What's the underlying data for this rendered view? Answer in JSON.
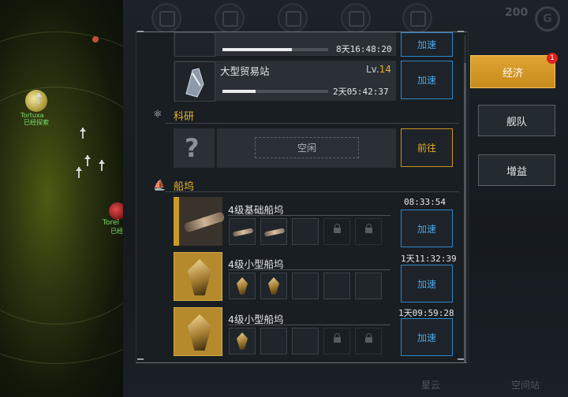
{
  "map": {
    "planet1_name": "Tortuxa",
    "planet1_status": "已经探索",
    "planet2_name": "Torel",
    "planet2_status": "已经探"
  },
  "top": {
    "resource_value": "200",
    "resource_icon": "G"
  },
  "bottom": {
    "label_1": "星云",
    "label_2": "空间站"
  },
  "economy": {
    "station_partial_timer": "8天16:48:20",
    "station_partial_button": "加速",
    "station_partial_progress": 0.66,
    "trade_station": {
      "title": "大型贸易站",
      "level_prefix": "Lv.",
      "level": "14",
      "timer": "2天05:42:37",
      "button": "加速",
      "progress": 0.31
    }
  },
  "research": {
    "header": "科研",
    "slot_status": "空闲",
    "button": "前往"
  },
  "shipyard": {
    "header": "船坞",
    "docks": [
      {
        "title": "4级基础船坞",
        "timer": "08:33:54",
        "button": "加速"
      },
      {
        "title": "4级小型船坞",
        "timer": "1天11:32:39",
        "button": "加速"
      },
      {
        "title": "4级小型船坞",
        "timer": "1天09:59:28",
        "button": "加速"
      }
    ]
  },
  "tabs": [
    {
      "label": "经济",
      "badge": "1"
    },
    {
      "label": "舰队"
    },
    {
      "label": "增益"
    }
  ],
  "colors": {
    "accent_gold": "#e3b12d",
    "button_blue": "#2f86c8",
    "active_tab": "#d59a29"
  }
}
